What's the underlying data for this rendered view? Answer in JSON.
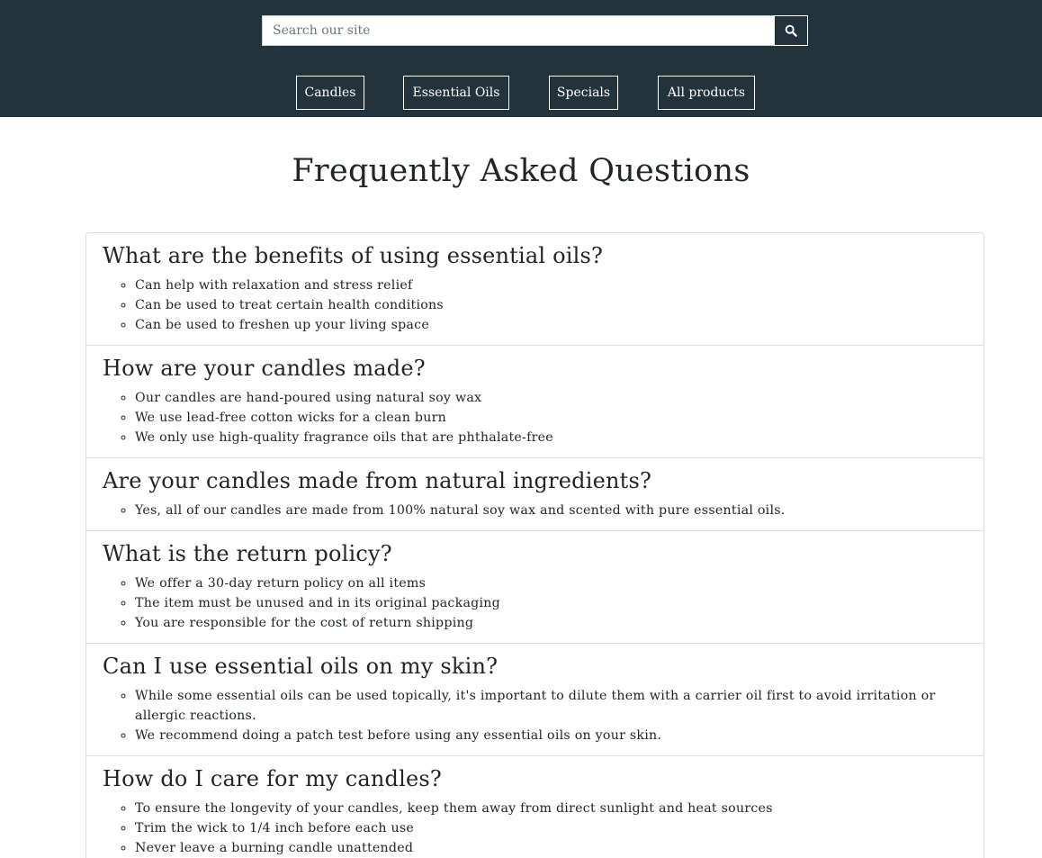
{
  "header": {
    "search": {
      "placeholder": "Search our site",
      "value": "",
      "button_icon": "search-icon"
    },
    "nav": [
      {
        "label": "Candles"
      },
      {
        "label": "Essential Oils"
      },
      {
        "label": "Specials"
      },
      {
        "label": "All products"
      }
    ],
    "colors": {
      "bar": "#22333b",
      "text": "#ffffff"
    }
  },
  "main": {
    "title": "Frequently Asked Questions",
    "faqs": [
      {
        "question": "What are the benefits of using essential oils?",
        "answers": [
          "Can help with relaxation and stress relief",
          "Can be used to treat certain health conditions",
          "Can be used to freshen up your living space"
        ]
      },
      {
        "question": "How are your candles made?",
        "answers": [
          "Our candles are hand-poured using natural soy wax",
          "We use lead-free cotton wicks for a clean burn",
          "We only use high-quality fragrance oils that are phthalate-free"
        ]
      },
      {
        "question": "Are your candles made from natural ingredients?",
        "answers": [
          "Yes, all of our candles are made from 100% natural soy wax and scented with pure essential oils."
        ]
      },
      {
        "question": "What is the return policy?",
        "answers": [
          "We offer a 30-day return policy on all items",
          "The item must be unused and in its original packaging",
          "You are responsible for the cost of return shipping"
        ]
      },
      {
        "question": "Can I use essential oils on my skin?",
        "answers": [
          "While some essential oils can be used topically, it's important to dilute them with a carrier oil first to avoid irritation or allergic reactions.",
          "We recommend doing a patch test before using any essential oils on your skin."
        ]
      },
      {
        "question": "How do I care for my candles?",
        "answers": [
          "To ensure the longevity of your candles, keep them away from direct sunlight and heat sources",
          "Trim the wick to 1/4 inch before each use",
          "Never leave a burning candle unattended"
        ]
      }
    ]
  }
}
